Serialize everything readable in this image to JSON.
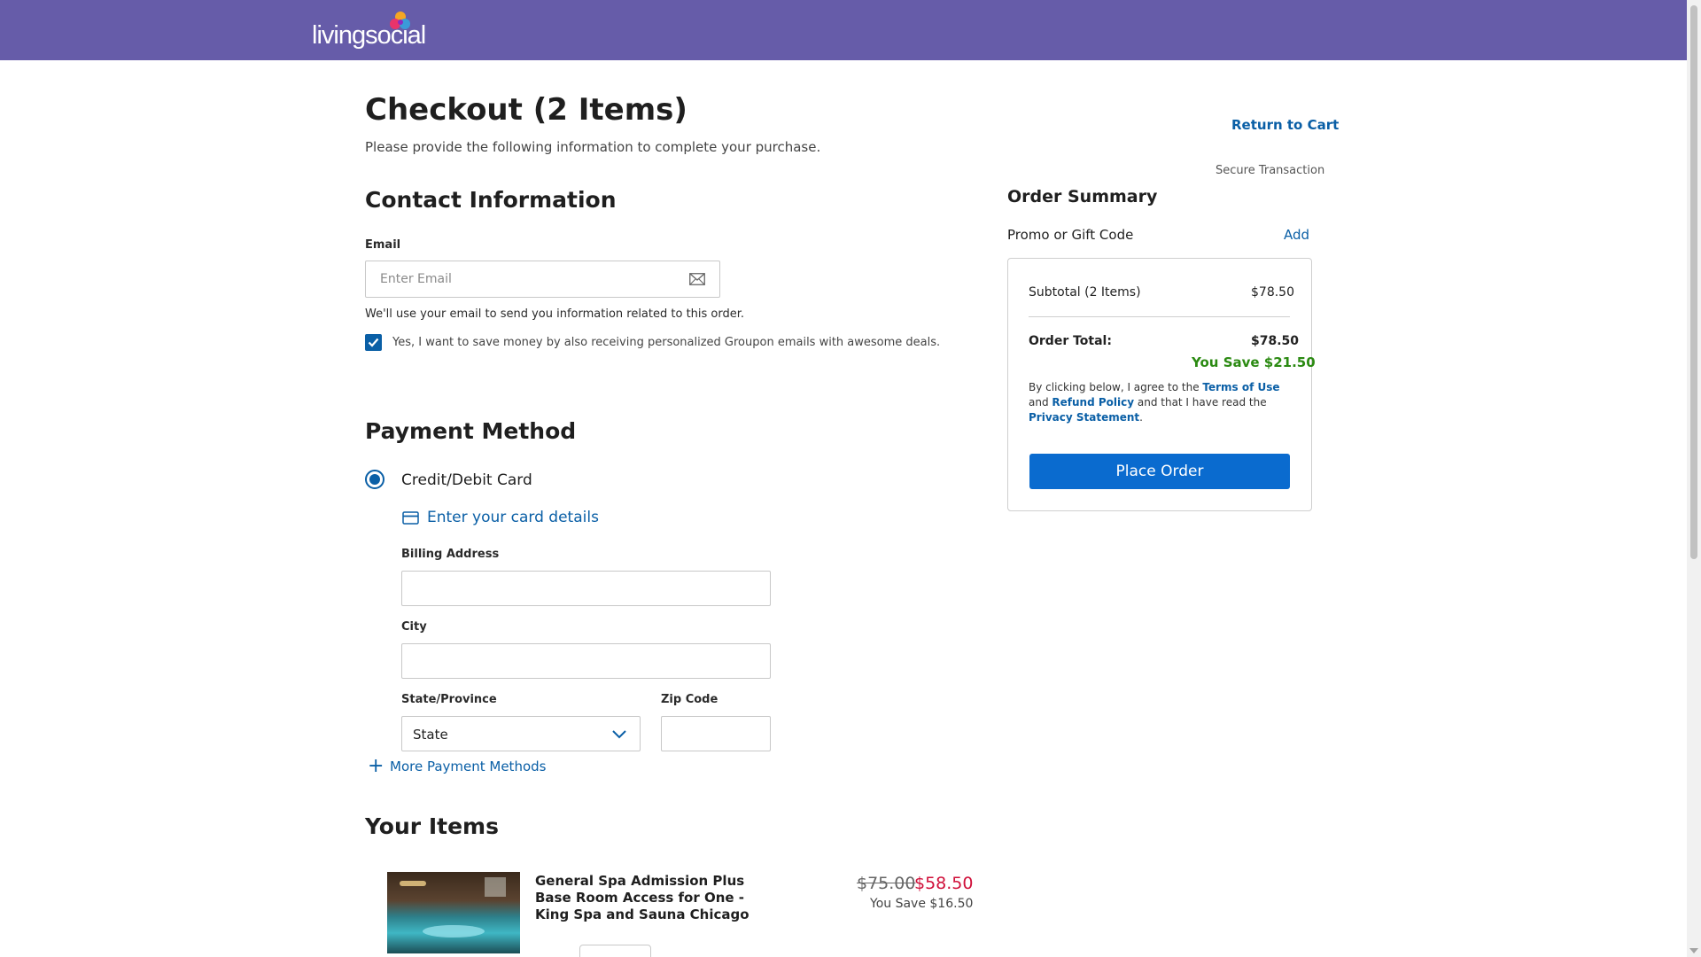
{
  "header": {
    "logo_text": "livingsocial"
  },
  "page": {
    "title": "Checkout (2 Items)",
    "subtitle": "Please provide the following information to complete your purchase.",
    "return_link": "Return to Cart",
    "secure": "Secure Transaction"
  },
  "contact": {
    "title": "Contact Information",
    "email_label": "Email",
    "email_placeholder": "Enter Email",
    "email_value": "",
    "hint": "We'll use your email to send you information related to this order.",
    "opt_in_label": "Yes, I want to save money by also receiving personalized Groupon emails with awesome deals.",
    "opt_in_checked": true
  },
  "payment": {
    "title": "Payment Method",
    "option_label": "Credit/Debit Card",
    "card_link": "Enter your card details",
    "billing_label": "Billing Address",
    "city_label": "City",
    "state_label": "State/Province",
    "state_value": "State",
    "zip_label": "Zip Code",
    "more_methods": "More Payment Methods"
  },
  "items": {
    "title": "Your Items",
    "list": [
      {
        "name": "General Spa Admission Plus Base Room Access for One - King Spa and Sauna Chicago",
        "price_old": "$75.00",
        "price_new": "$58.50",
        "save": "You Save $16.50"
      }
    ]
  },
  "summary": {
    "title": "Order Summary",
    "promo_label": "Promo or Gift Code",
    "promo_add": "Add",
    "subtotal_label": "Subtotal (2 Items)",
    "subtotal_value": "$78.50",
    "total_label": "Order Total:",
    "total_value": "$78.50",
    "you_save": "You Save $21.50",
    "legal_1": "By clicking below, I agree to the ",
    "terms": "Terms of Use",
    "legal_2": " and ",
    "refund": "Refund Policy",
    "legal_3": " and that I have read the ",
    "privacy": "Privacy Statement",
    "legal_4": ".",
    "place_order": "Place Order"
  },
  "colors": {
    "header_bg": "#665ca9",
    "link": "#0a5fa6",
    "primary_button": "#0a6bcf",
    "sale_price": "#d0103a",
    "savings": "#2b8a12"
  }
}
